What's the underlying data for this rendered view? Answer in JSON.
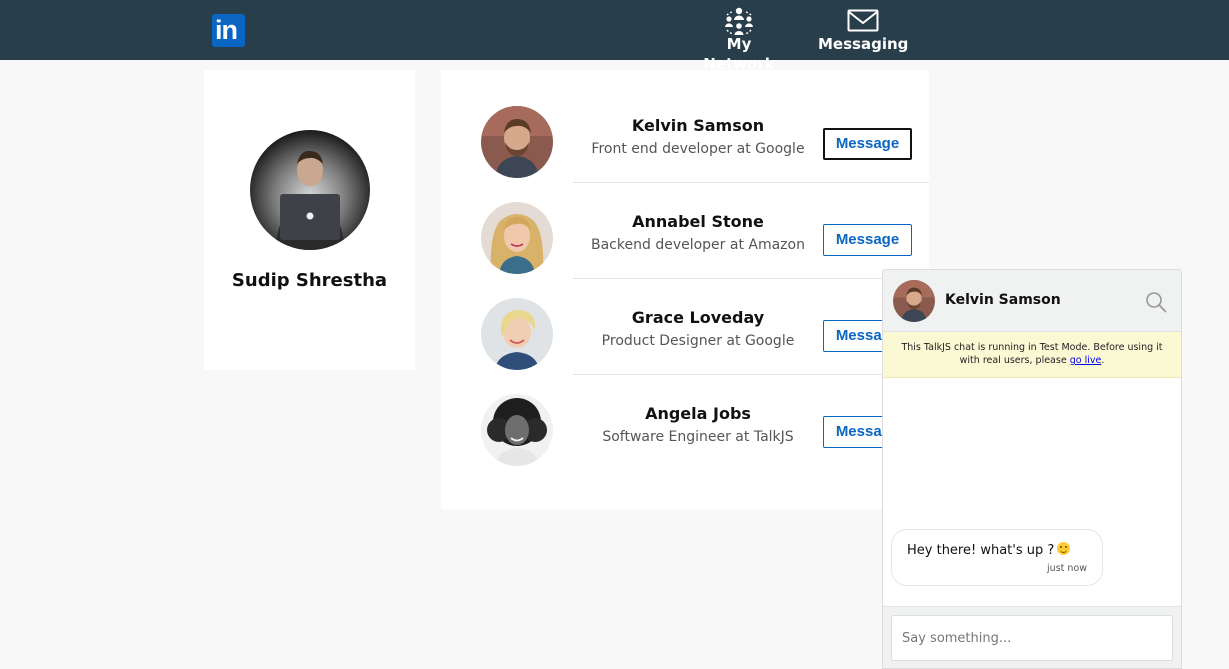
{
  "header": {
    "logo_text": "in",
    "nav": [
      {
        "label": "My Network",
        "icon": "network-icon"
      },
      {
        "label": "Messaging",
        "icon": "envelope-icon"
      }
    ]
  },
  "profile": {
    "name": "Sudip Shrestha"
  },
  "contacts": [
    {
      "name": "Kelvin Samson",
      "title": "Front end developer at Google",
      "button": "Message"
    },
    {
      "name": "Annabel Stone",
      "title": "Backend developer at Amazon",
      "button": "Message"
    },
    {
      "name": "Grace Loveday",
      "title": "Product Designer at Google",
      "button": "Message"
    },
    {
      "name": "Angela Jobs",
      "title": "Software Engineer at TalkJS",
      "button": "Message"
    }
  ],
  "chat": {
    "contact_name": "Kelvin Samson",
    "banner_text": "This TalkJS chat is running in Test Mode. Before using it with real users, please ",
    "banner_link": "go live",
    "banner_end": ".",
    "message": {
      "text": "Hey there! what's up ?",
      "time": "just now"
    },
    "input_placeholder": "Say something..."
  },
  "colors": {
    "header_bg": "#283e4a",
    "brand_blue": "#0a66c2",
    "banner_bg": "#fbf8d4"
  }
}
